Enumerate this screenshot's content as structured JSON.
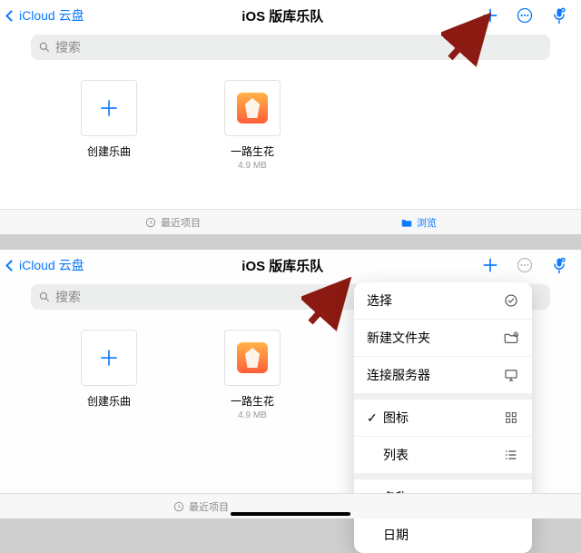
{
  "colors": {
    "accent": "#0a7aff"
  },
  "top": {
    "back_label": "iCloud 云盘",
    "title": "iOS 版库乐队",
    "search_placeholder": "搜索",
    "tiles": [
      {
        "name": "创建乐曲",
        "size": ""
      },
      {
        "name": "一路生花",
        "size": "4.9 MB"
      }
    ],
    "tabs": {
      "recent": "最近项目",
      "browse": "浏览"
    }
  },
  "bottom": {
    "back_label": "iCloud 云盘",
    "title": "iOS 版库乐队",
    "search_placeholder": "搜索",
    "tiles": [
      {
        "name": "创建乐曲",
        "size": ""
      },
      {
        "name": "一路生花",
        "size": "4.9 MB"
      }
    ],
    "menu": {
      "select": "选择",
      "new_folder": "新建文件夹",
      "connect_server": "连接服务器",
      "icons": "图标",
      "list": "列表",
      "name": "名称",
      "date": "日期",
      "checked_view": "icons",
      "checked_sort": "name"
    },
    "tabs": {
      "recent": "最近项目"
    }
  }
}
